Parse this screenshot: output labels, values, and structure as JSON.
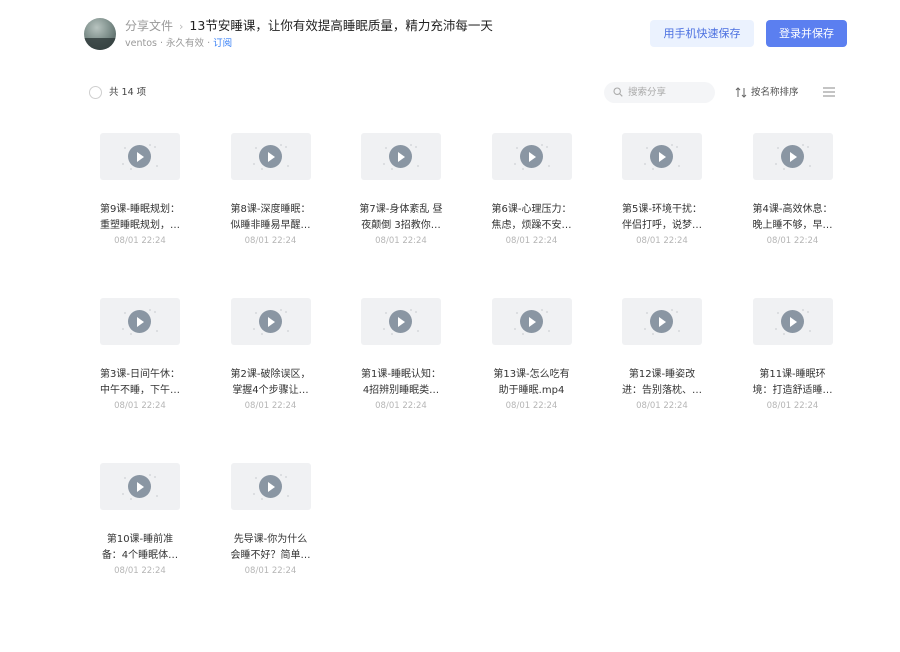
{
  "header": {
    "breadcrumb_root": "分享文件",
    "breadcrumb_sep": "›",
    "title": "13节安睡课，让你有效提高睡眠质量，精力充沛每一天",
    "owner": "ventos",
    "validity": "永久有效",
    "subscribe": "订阅",
    "phone_save_label": "用手机快速保存",
    "login_save_label": "登录并保存"
  },
  "toolbar": {
    "count_label": "共 14 项",
    "search_placeholder": "搜索分享",
    "sort_label": "按名称排序"
  },
  "files": [
    {
      "name": "第9课-睡眠规划：\n重塑睡眠规划，…",
      "date": "08/01 22:24"
    },
    {
      "name": "第8课-深度睡眠：\n似睡非睡易早醒…",
      "date": "08/01 22:24"
    },
    {
      "name": "第7课-身体紊乱 昼\n夜颠倒 3招教你…",
      "date": "08/01 22:24"
    },
    {
      "name": "第6课-心理压力：\n焦虑，烦躁不安…",
      "date": "08/01 22:24"
    },
    {
      "name": "第5课-环境干扰：\n伴侣打呼，说梦…",
      "date": "08/01 22:24"
    },
    {
      "name": "第4课-高效休息：\n晚上睡不够，早…",
      "date": "08/01 22:24"
    },
    {
      "name": "第3课-日间午休：\n中午不睡，下午…",
      "date": "08/01 22:24"
    },
    {
      "name": "第2课-破除误区，\n掌握4个步骤让…",
      "date": "08/01 22:24"
    },
    {
      "name": "第1课-睡眠认知：\n4招辨别睡眠类…",
      "date": "08/01 22:24"
    },
    {
      "name": "第13课-怎么吃有\n助于睡眠.mp4",
      "date": "08/01 22:24"
    },
    {
      "name": "第12课-睡姿改\n进：告别落枕、…",
      "date": "08/01 22:24"
    },
    {
      "name": "第11课-睡眠环\n境：打造舒适睡…",
      "date": "08/01 22:24"
    },
    {
      "name": "第10课-睡前准\n备：4个睡眠体…",
      "date": "08/01 22:24"
    },
    {
      "name": "先导课-你为什么\n会睡不好？简单…",
      "date": "08/01 22:24"
    }
  ]
}
